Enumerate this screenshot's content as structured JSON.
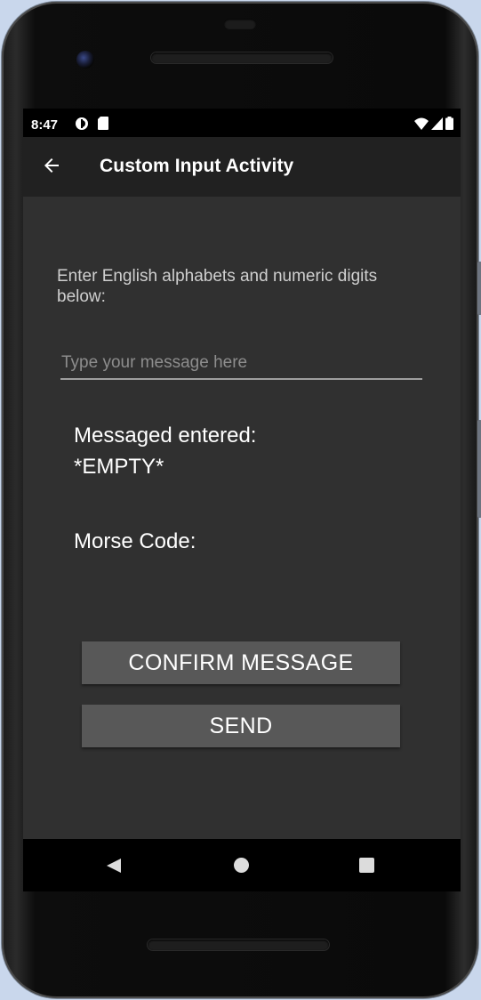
{
  "statusbar": {
    "time": "8:47",
    "left_icons": [
      "data-saver-icon",
      "sd-card-icon"
    ],
    "right_icons": [
      "wifi-icon",
      "signal-icon",
      "battery-icon"
    ]
  },
  "appbar": {
    "title": "Custom Input Activity",
    "back_icon": "arrow-left-icon"
  },
  "main": {
    "instructions": "Enter English alphabets and numeric digits below:",
    "input": {
      "placeholder": "Type your message here",
      "value": ""
    },
    "message_label": "Messaged entered:",
    "message_value": "*EMPTY*",
    "morse_label": "Morse Code:",
    "confirm_button": "CONFIRM MESSAGE",
    "send_button": "SEND"
  },
  "navbar": {
    "icons": [
      "back-triangle-icon",
      "home-circle-icon",
      "recents-square-icon"
    ]
  },
  "colors": {
    "appbar": "#212121",
    "content": "#303030",
    "button": "#585858",
    "text": "#ffffff"
  }
}
